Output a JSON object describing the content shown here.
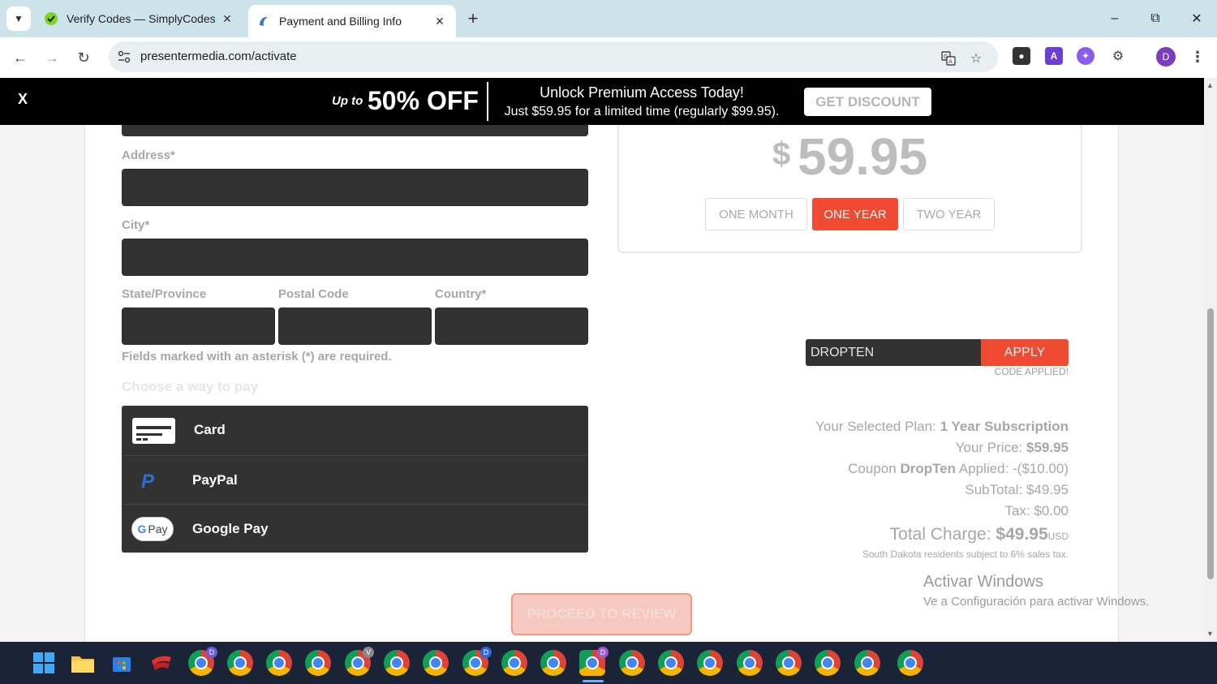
{
  "browser": {
    "tabs": [
      {
        "title": "Verify Codes — SimplyCodes",
        "active": false
      },
      {
        "title": "Payment and Billing Info",
        "active": true
      }
    ],
    "url": "presentermedia.com/activate",
    "profile_initial": "D",
    "extension_a_label": "A"
  },
  "promo": {
    "close": "X",
    "up_to": "Up to",
    "discount": "50% OFF",
    "headline": "Unlock Premium Access Today!",
    "subline": "Just $59.95 for a limited time (regularly $99.95).",
    "button": "GET DISCOUNT"
  },
  "form": {
    "address_label": "Address*",
    "city_label": "City*",
    "state_label": "State/Province",
    "postal_label": "Postal Code",
    "country_label": "Country*",
    "required_note": "Fields marked with an asterisk (*) are required.",
    "choose_pay": "Choose a way to pay",
    "pay_options": [
      "Card",
      "PayPal",
      "Google Pay"
    ],
    "gpay_badge": "Pay",
    "proceed": "PROCEED TO REVIEW"
  },
  "pricing": {
    "currency_symbol": "$",
    "price": "59.95",
    "plans": [
      {
        "label": "ONE MONTH",
        "active": false
      },
      {
        "label": "ONE YEAR",
        "active": true
      },
      {
        "label": "TWO YEAR",
        "active": false
      }
    ]
  },
  "coupon": {
    "code": "DROPTEN",
    "apply": "APPLY",
    "status": "CODE APPLIED!"
  },
  "summary": {
    "plan_label": "Your Selected Plan:",
    "plan_value": "1 Year Subscription",
    "price_label": "Your Price:",
    "price_value": "$59.95",
    "coupon_prefix": "Coupon",
    "coupon_name": "DropTen",
    "coupon_suffix": "Applied: -($10.00)",
    "subtotal": "SubTotal: $49.95",
    "tax": "Tax: $0.00",
    "total_label": "Total Charge:",
    "total_value": "$49.95",
    "total_currency": "USD",
    "tax_note": "South Dakota residents subject to 6% sales tax."
  },
  "watermark": {
    "line1": "Activar Windows",
    "line2": "Ve a Configuración para activar Windows."
  },
  "taskbar": {
    "badges": [
      "D",
      "",
      "",
      "",
      "V",
      "",
      "",
      "D",
      "",
      "",
      "D",
      "",
      "",
      "",
      "",
      "",
      "",
      "",
      ""
    ]
  },
  "colors": {
    "accent": "#ee4b32",
    "field_bg": "#323232",
    "promo_bg": "#000000",
    "tabstrip": "#cde3ea"
  }
}
